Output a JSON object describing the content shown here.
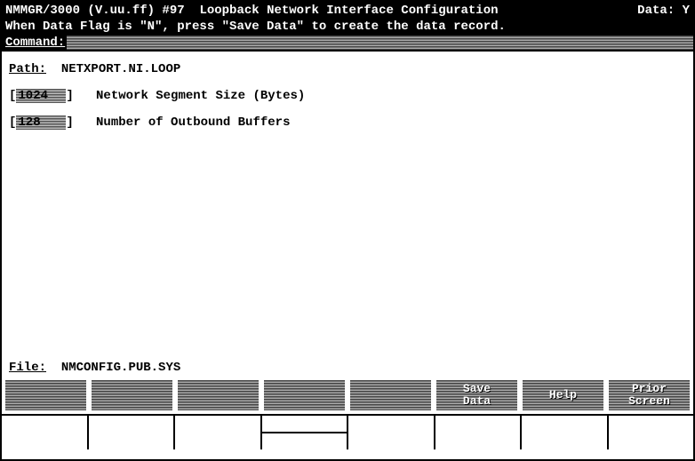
{
  "title": {
    "app": "NMMGR/3000 (V.uu.ff) #97",
    "screen": "Loopback Network Interface Configuration",
    "data_label": "Data:",
    "data_flag": "Y"
  },
  "message": "When Data Flag is \"N\", press \"Save Data\" to create the data record.",
  "command": {
    "label": "Command:",
    "value": ""
  },
  "path": {
    "label": "Path:",
    "value": "NETXPORT.NI.LOOP"
  },
  "fields": [
    {
      "value": "1024 ",
      "label": "Network Segment Size (Bytes)"
    },
    {
      "value": "128  ",
      "label": "Number of Outbound Buffers"
    }
  ],
  "file": {
    "label": "File:",
    "value": "NMCONFIG.PUB.SYS"
  },
  "fkeys": [
    {
      "line1": "",
      "line2": ""
    },
    {
      "line1": "",
      "line2": ""
    },
    {
      "line1": "",
      "line2": ""
    },
    {
      "line1": "",
      "line2": ""
    },
    {
      "line1": "",
      "line2": ""
    },
    {
      "line1": "Save",
      "line2": "Data"
    },
    {
      "line1": "Help",
      "line2": ""
    },
    {
      "line1": "Prior",
      "line2": "Screen"
    }
  ]
}
